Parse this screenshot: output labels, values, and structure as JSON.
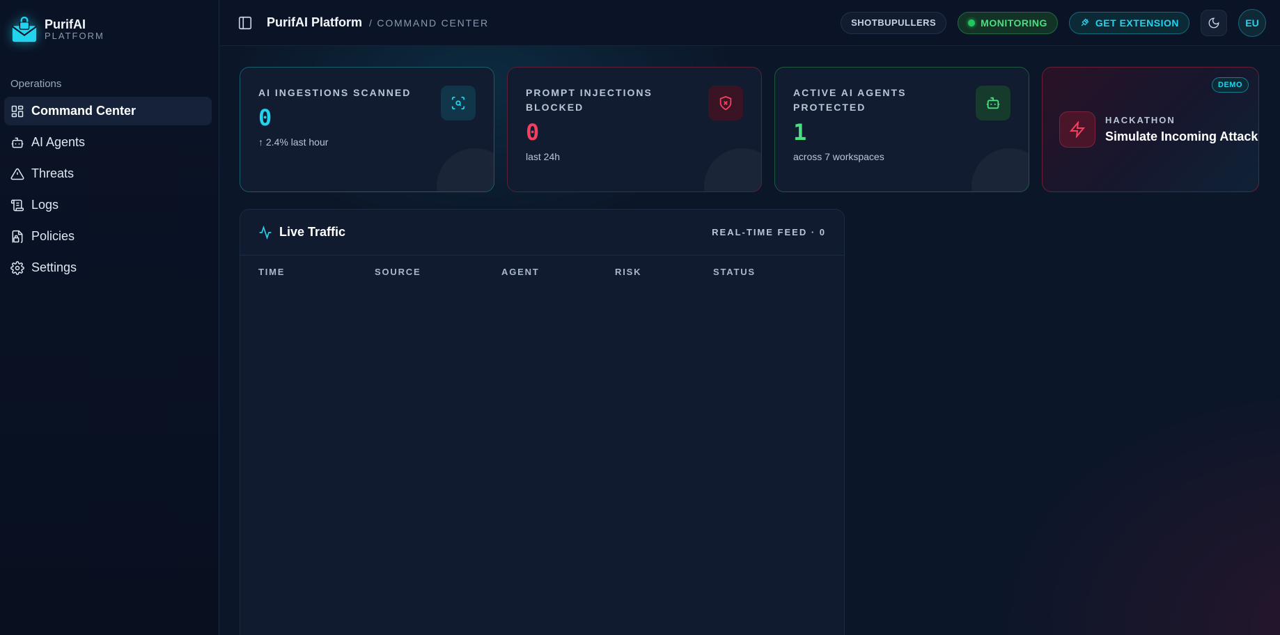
{
  "brand": {
    "name": "PurifAI",
    "sub": "PLATFORM"
  },
  "sidebar": {
    "group_label": "Operations",
    "items": [
      {
        "label": "Command Center",
        "icon": "dashboard-icon",
        "active": true
      },
      {
        "label": "AI Agents",
        "icon": "bot-icon"
      },
      {
        "label": "Threats",
        "icon": "warning-icon"
      },
      {
        "label": "Logs",
        "icon": "scroll-icon"
      },
      {
        "label": "Policies",
        "icon": "file-lock-icon"
      },
      {
        "label": "Settings",
        "icon": "gear-icon"
      }
    ]
  },
  "header": {
    "title": "PurifAI Platform",
    "separator": "/",
    "section": "COMMAND CENTER",
    "workspace": "SHOTBUPULLERS",
    "monitoring": "MONITORING",
    "extension": "GET EXTENSION",
    "avatar": "EU"
  },
  "cards": [
    {
      "label": "AI INGESTIONS SCANNED",
      "value": "0",
      "sub": "↑ 2.4% last hour",
      "accent": "#22d3ee"
    },
    {
      "label": "PROMPT INJECTIONS BLOCKED",
      "value": "0",
      "sub": "last 24h",
      "accent": "#f43f5e"
    },
    {
      "label": "ACTIVE AI AGENTS PROTECTED",
      "value": "1",
      "sub": "across 7 workspaces",
      "accent": "#4ade80"
    }
  ],
  "demo": {
    "badge": "DEMO",
    "kicker": "HACKATHON",
    "title": "Simulate Incoming Attack"
  },
  "traffic": {
    "title": "Live Traffic",
    "feed": "REAL-TIME FEED · 0",
    "columns": [
      "TIME",
      "SOURCE",
      "AGENT",
      "RISK",
      "STATUS"
    ]
  }
}
